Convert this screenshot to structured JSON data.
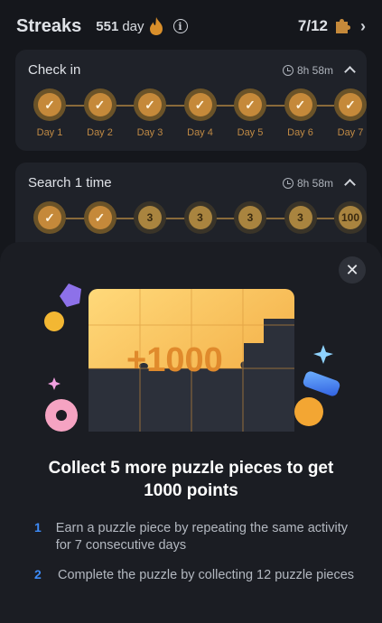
{
  "header": {
    "title": "Streaks",
    "streak_count": "551",
    "streak_unit": "day",
    "puzzle_progress": "7/12"
  },
  "checkin": {
    "title": "Check in",
    "timer": "8h 58m",
    "days": [
      "Day 1",
      "Day 2",
      "Day 3",
      "Day 4",
      "Day 5",
      "Day 6",
      "Day 7"
    ]
  },
  "search": {
    "title": "Search 1 time",
    "timer": "8h 58m",
    "medal_values": [
      "3",
      "3",
      "3",
      "3",
      "3"
    ],
    "bonus": "100"
  },
  "modal": {
    "art_text": "+1000",
    "headline": "Collect 5 more puzzle pieces to get 1000 points",
    "steps": [
      {
        "num": "1",
        "text": "Earn a puzzle piece by repeating the same activity for 7 consecutive days"
      },
      {
        "num": "2",
        "text": "Complete the puzzle by collecting 12 puzzle pieces"
      }
    ]
  },
  "colors": {
    "accent": "#3d8bf7",
    "gold": "#c5893a"
  }
}
